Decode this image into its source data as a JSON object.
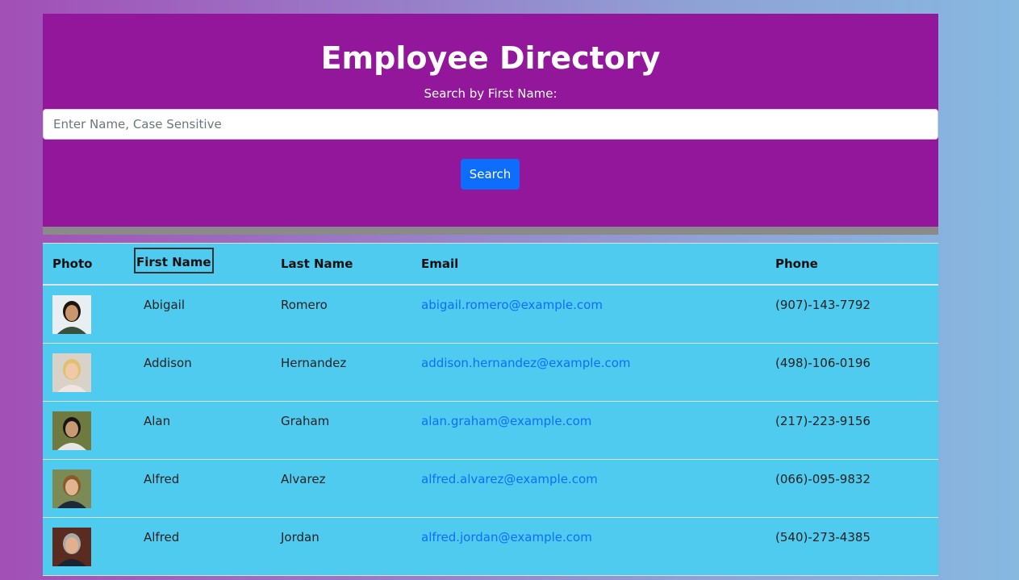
{
  "header": {
    "title": "Employee Directory",
    "search_label": "Search by First Name:",
    "search_placeholder": "Enter Name, Case Sensitive",
    "search_value": "",
    "search_button_label": "Search",
    "background_color": "#93179b",
    "button_color": "#0d6efd"
  },
  "table": {
    "columns": [
      "Photo",
      "First Name",
      "Last Name",
      "Email",
      "Phone"
    ],
    "background_color": "#4ecbef",
    "rows": [
      {
        "first": "Abigail",
        "last": "Romero",
        "email": "abigail.romero@example.com",
        "phone": "(907)-143-7792",
        "photo_icon": "portrait-photo"
      },
      {
        "first": "Addison",
        "last": "Hernandez",
        "email": "addison.hernandez@example.com",
        "phone": "(498)-106-0196",
        "photo_icon": "portrait-photo"
      },
      {
        "first": "Alan",
        "last": "Graham",
        "email": "alan.graham@example.com",
        "phone": "(217)-223-9156",
        "photo_icon": "portrait-photo"
      },
      {
        "first": "Alfred",
        "last": "Alvarez",
        "email": "alfred.alvarez@example.com",
        "phone": "(066)-095-9832",
        "photo_icon": "portrait-photo"
      },
      {
        "first": "Alfred",
        "last": "Jordan",
        "email": "alfred.jordan@example.com",
        "phone": "(540)-273-4385",
        "photo_icon": "portrait-photo"
      }
    ]
  }
}
